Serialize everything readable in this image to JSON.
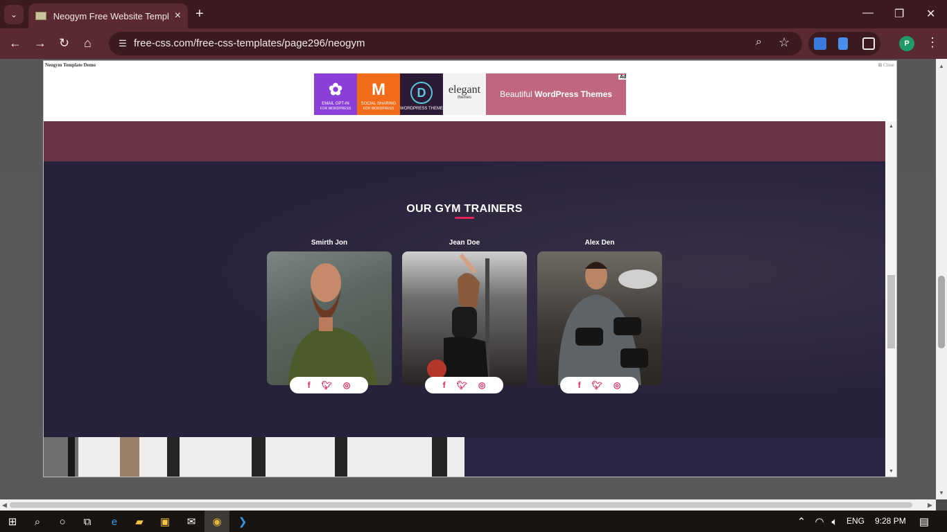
{
  "browser": {
    "tab_title": "Neogym Free Website Template",
    "url": "free-css.com/free-css-templates/page296/neogym",
    "profile_initial": "P"
  },
  "demo_bar": {
    "title": "Neogym Template Demo",
    "close_label": "Close"
  },
  "ad": {
    "tiles": [
      {
        "label": "EMAIL OPT-IN",
        "sub": "FOR WORDPRESS",
        "color": "#8b3fd9"
      },
      {
        "label": "SOCIAL SHARING",
        "sub": "FOR WORDPRESS",
        "color": "#f36a18"
      },
      {
        "label": "WORDPRESS THEME",
        "sub": "",
        "color": "#2c1a36"
      }
    ],
    "elegant_label": "elegant",
    "elegant_sub": "themes",
    "banner_prefix": "Beautiful ",
    "banner_bold": "WordPress Themes",
    "ad_badge": "Ad"
  },
  "section": {
    "title": "OUR GYM TRAINERS"
  },
  "trainers": [
    {
      "name": "Smirth Jon"
    },
    {
      "name": "Jean Doe"
    },
    {
      "name": "Alex Den"
    }
  ],
  "social_icons": [
    "facebook-icon",
    "twitter-icon",
    "instagram-icon"
  ],
  "taskbar": {
    "language": "ENG",
    "time": "9:28 PM"
  },
  "colors": {
    "accent": "#e0245e",
    "section_bg": "#27213a",
    "chrome_dark": "#3b1b1f",
    "chrome_mid": "#5b2a30"
  }
}
